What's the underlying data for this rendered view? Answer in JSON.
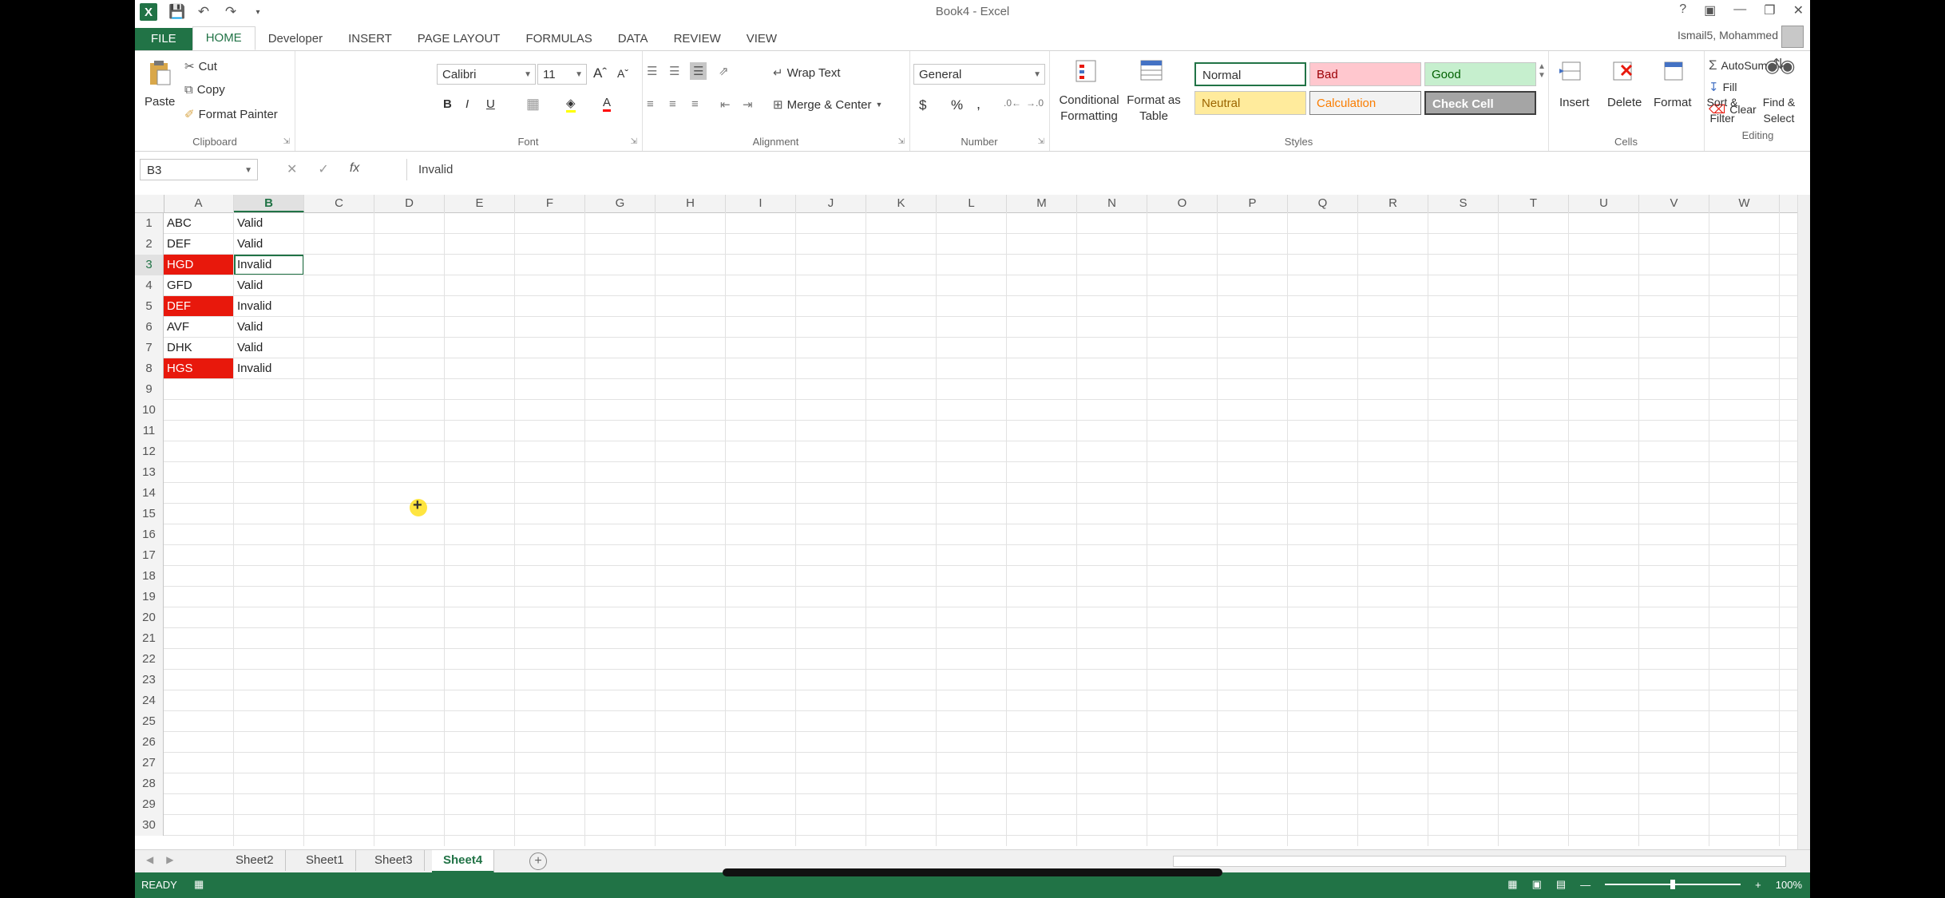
{
  "window": {
    "title": "Book4 - Excel",
    "user": "Ismail5, Mohammed"
  },
  "qat": {
    "logo": "X"
  },
  "tabs": [
    "FILE",
    "HOME",
    "Developer",
    "INSERT",
    "PAGE LAYOUT",
    "FORMULAS",
    "DATA",
    "REVIEW",
    "VIEW"
  ],
  "active_tab": "HOME",
  "ribbon": {
    "clipboard": {
      "label": "Clipboard",
      "paste": "Paste",
      "cut": "Cut",
      "copy": "Copy",
      "format_painter": "Format Painter"
    },
    "font": {
      "label": "Font",
      "family": "Calibri",
      "size": "11",
      "bold": "B",
      "italic": "I",
      "underline": "U"
    },
    "alignment": {
      "label": "Alignment",
      "wrap_text": "Wrap Text",
      "merge_center": "Merge & Center"
    },
    "number": {
      "label": "Number",
      "format": "General",
      "currency": "$",
      "percent": "%",
      "comma": ","
    },
    "styles": {
      "label": "Styles",
      "conditional_formatting": "Conditional Formatting",
      "format_as_table": "Format as Table",
      "normal": "Normal",
      "bad": "Bad",
      "good": "Good",
      "neutral": "Neutral",
      "calculation": "Calculation",
      "check_cell": "Check Cell"
    },
    "cells": {
      "label": "Cells",
      "insert": "Insert",
      "delete": "Delete",
      "format": "Format"
    },
    "editing": {
      "label": "Editing",
      "autosum": "AutoSum",
      "fill": "Fill",
      "clear": "Clear",
      "sort_filter": "Sort & Filter",
      "find_select": "Find & Select"
    }
  },
  "formula_bar": {
    "name_box": "B3",
    "fx": "fx",
    "content": "Invalid"
  },
  "columns": [
    "A",
    "B",
    "C",
    "D",
    "E",
    "F",
    "G",
    "H",
    "I",
    "J",
    "K",
    "L",
    "M",
    "N",
    "O",
    "P",
    "Q",
    "R",
    "S",
    "T",
    "U",
    "V",
    "W"
  ],
  "selected_column": "B",
  "row_count": 30,
  "selected_row": 3,
  "cells": [
    {
      "row": 1,
      "a": "ABC",
      "b": "Valid",
      "highlight": false
    },
    {
      "row": 2,
      "a": "DEF",
      "b": "Valid",
      "highlight": false
    },
    {
      "row": 3,
      "a": "HGD",
      "b": "Invalid",
      "highlight": true
    },
    {
      "row": 4,
      "a": "GFD",
      "b": "Valid",
      "highlight": false
    },
    {
      "row": 5,
      "a": "DEF",
      "b": "Invalid",
      "highlight": true
    },
    {
      "row": 6,
      "a": "AVF",
      "b": "Valid",
      "highlight": false
    },
    {
      "row": 7,
      "a": "DHK",
      "b": "Valid",
      "highlight": false
    },
    {
      "row": 8,
      "a": "HGS",
      "b": "Invalid",
      "highlight": true
    }
  ],
  "sheets": [
    "Sheet2",
    "Sheet1",
    "Sheet3",
    "Sheet4"
  ],
  "active_sheet": "Sheet4",
  "status": {
    "text": "READY",
    "zoom": "100%"
  },
  "colors": {
    "accent": "#217346",
    "highlight": "#e8180c"
  }
}
